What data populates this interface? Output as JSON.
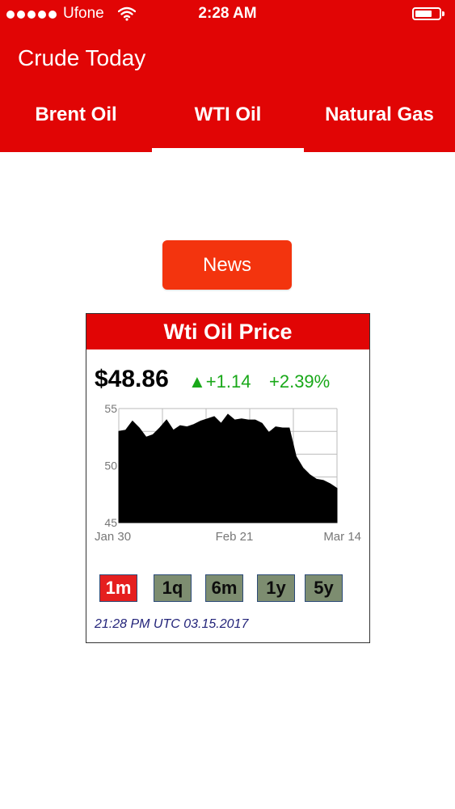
{
  "status_bar": {
    "carrier": "Ufone",
    "time": "2:28 AM"
  },
  "app": {
    "title": "Crude Today",
    "brand_color": "#e10505"
  },
  "tabs": [
    {
      "label": "Brent Oil",
      "active": false
    },
    {
      "label": "WTI Oil",
      "active": true
    },
    {
      "label": "Natural Gas",
      "active": false
    }
  ],
  "news_button": {
    "label": "News"
  },
  "widget": {
    "title": "Wti Oil Price",
    "price": "$48.86",
    "change": "+1.14",
    "change_pct": "+2.39%",
    "change_icon": "up-triangle-icon",
    "timestamp": "21:28 PM UTC 03.15.2017",
    "ranges": [
      {
        "label": "1m",
        "active": true
      },
      {
        "label": "1q",
        "active": false
      },
      {
        "label": "6m",
        "active": false
      },
      {
        "label": "1y",
        "active": false
      },
      {
        "label": "5y",
        "active": false
      }
    ]
  },
  "chart_data": {
    "type": "area",
    "title": "",
    "xlabel": "",
    "ylabel": "",
    "ylim": [
      45,
      55
    ],
    "y_ticks": [
      "45",
      "50",
      "55"
    ],
    "x_ticks": [
      "Jan 30",
      "Feb 21",
      "Mar 14"
    ],
    "grid": true,
    "color": "#000000",
    "x": [
      0,
      1,
      2,
      3,
      4,
      5,
      6,
      7,
      8,
      9,
      10,
      11,
      12,
      13,
      14,
      15,
      16,
      17,
      18,
      19,
      20,
      21,
      22,
      23,
      24,
      25,
      26,
      27,
      28,
      29,
      30,
      31,
      32
    ],
    "values": [
      53.0,
      53.1,
      53.9,
      53.3,
      52.5,
      52.7,
      53.3,
      54.0,
      53.1,
      53.5,
      53.4,
      53.6,
      53.9,
      54.1,
      54.3,
      53.7,
      54.5,
      54.0,
      54.1,
      54.0,
      54.0,
      53.7,
      52.9,
      53.4,
      53.3,
      53.3,
      50.8,
      49.8,
      49.2,
      48.8,
      48.7,
      48.4,
      48.0
    ]
  }
}
